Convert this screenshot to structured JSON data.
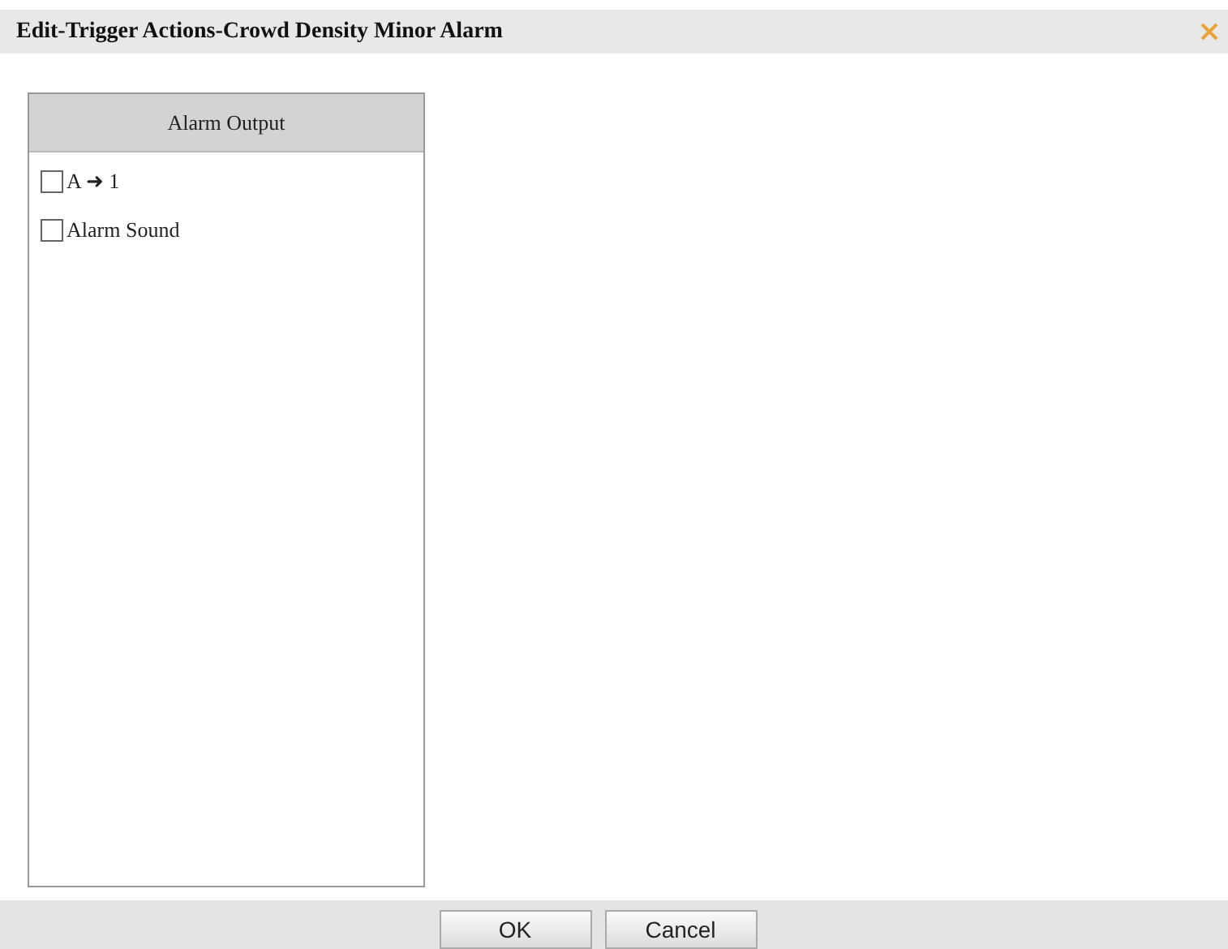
{
  "window": {
    "title": "Edit-Trigger Actions-Crowd Density Minor Alarm"
  },
  "panel": {
    "header": "Alarm Output",
    "items": [
      {
        "label": "A ➜ 1",
        "checked": false
      },
      {
        "label": "Alarm Sound",
        "checked": false
      }
    ]
  },
  "buttons": [
    "OK",
    "Cancel"
  ]
}
